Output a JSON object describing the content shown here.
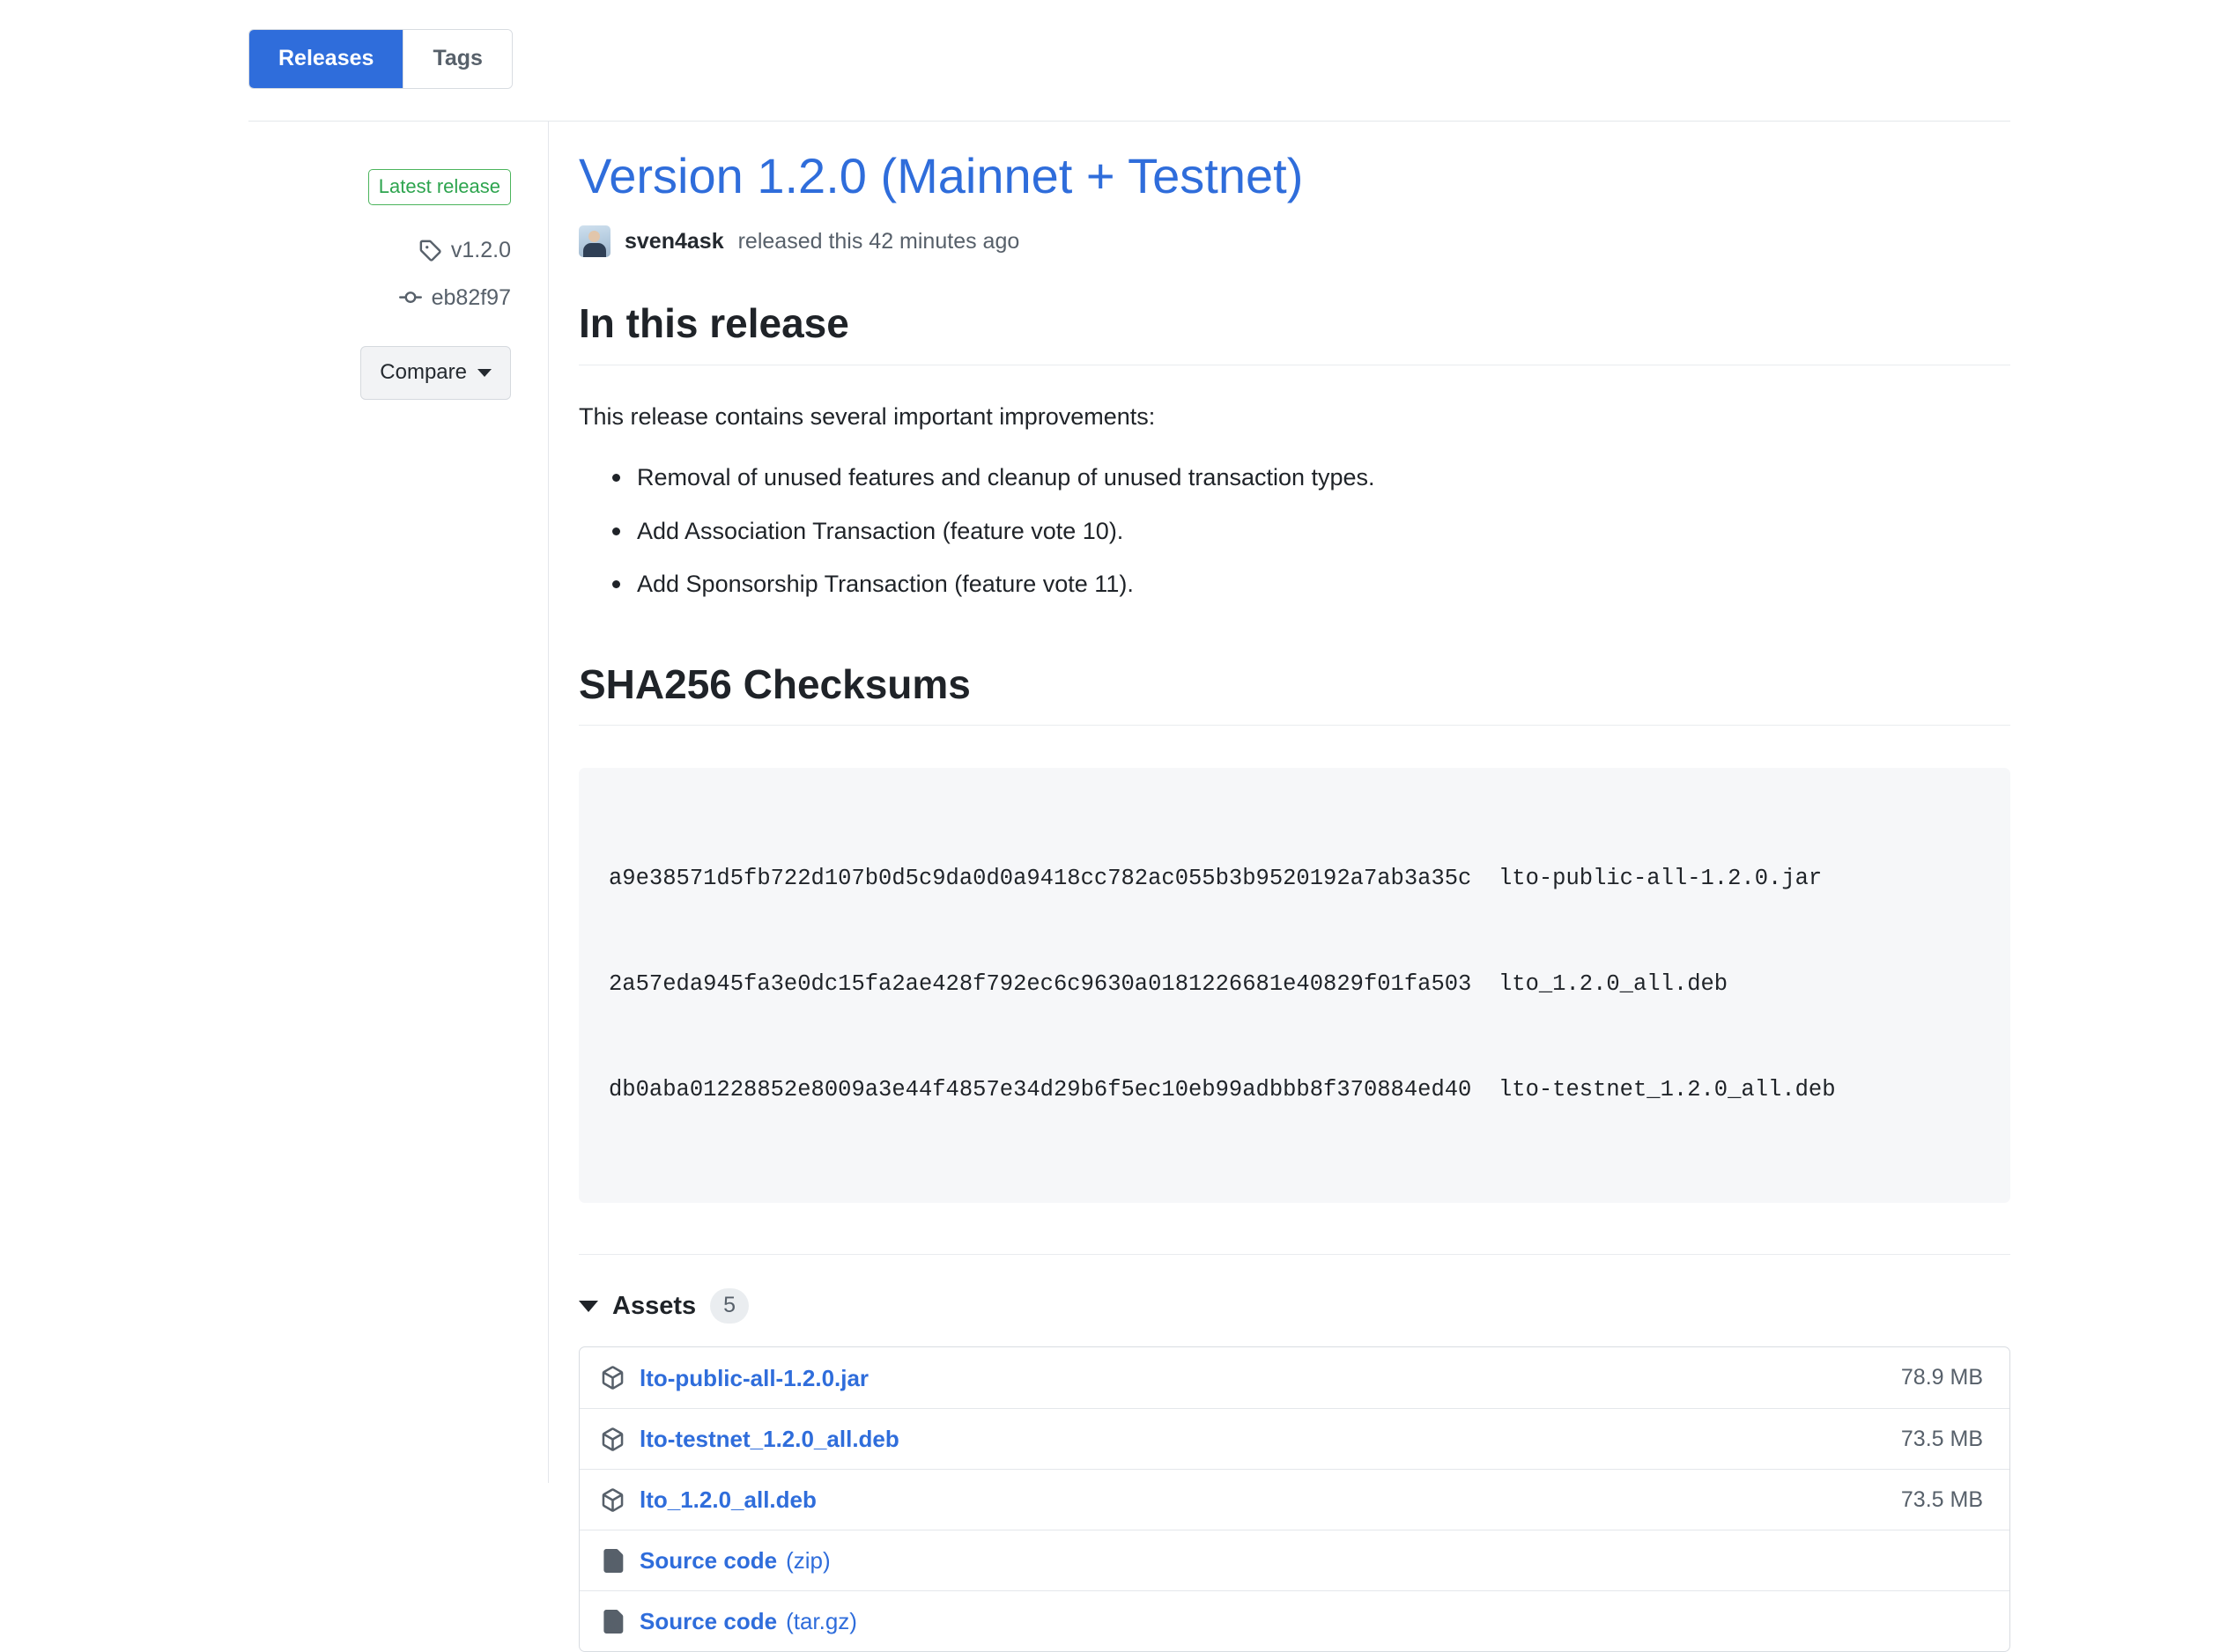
{
  "tabs": [
    {
      "label": "Releases",
      "selected": true
    },
    {
      "label": "Tags",
      "selected": false
    }
  ],
  "sidebar": {
    "latest_badge": "Latest release",
    "tag": "v1.2.0",
    "commit": "eb82f97",
    "compare_label": "Compare"
  },
  "release": {
    "title": "Version 1.2.0 (Mainnet + Testnet)",
    "author": "sven4ask",
    "byline_suffix": "released this 42 minutes ago"
  },
  "body": {
    "heading_1": "In this release",
    "intro": "This release contains several important improvements:",
    "bullets": [
      "Removal of unused features and cleanup of unused transaction types.",
      "Add Association Transaction (feature vote 10).",
      "Add Sponsorship Transaction (feature vote 11)."
    ],
    "heading_2": "SHA256 Checksums",
    "checksums": [
      "a9e38571d5fb722d107b0d5c9da0d0a9418cc782ac055b3b9520192a7ab3a35c  lto-public-all-1.2.0.jar",
      "2a57eda945fa3e0dc15fa2ae428f792ec6c9630a0181226681e40829f01fa503  lto_1.2.0_all.deb",
      "db0aba01228852e8009a3e44f4857e34d29b6f5ec10eb99adbbb8f370884ed40  lto-testnet_1.2.0_all.deb"
    ]
  },
  "assets": {
    "label": "Assets",
    "count": "5",
    "rows": [
      {
        "icon": "package-icon",
        "name": "lto-public-all-1.2.0.jar",
        "suffix": "",
        "size": "78.9 MB"
      },
      {
        "icon": "package-icon",
        "name": "lto-testnet_1.2.0_all.deb",
        "suffix": "",
        "size": "73.5 MB"
      },
      {
        "icon": "package-icon",
        "name": "lto_1.2.0_all.deb",
        "suffix": "",
        "size": "73.5 MB"
      },
      {
        "icon": "file-zip-icon",
        "name": "Source code",
        "suffix": "(zip)",
        "size": ""
      },
      {
        "icon": "file-zip-icon",
        "name": "Source code",
        "suffix": "(tar.gz)",
        "size": ""
      }
    ]
  },
  "colors": {
    "link": "#2f6ddb",
    "accent_tab": "#2f6ddb",
    "badge_green": "#2da44e",
    "muted": "#57606a"
  }
}
